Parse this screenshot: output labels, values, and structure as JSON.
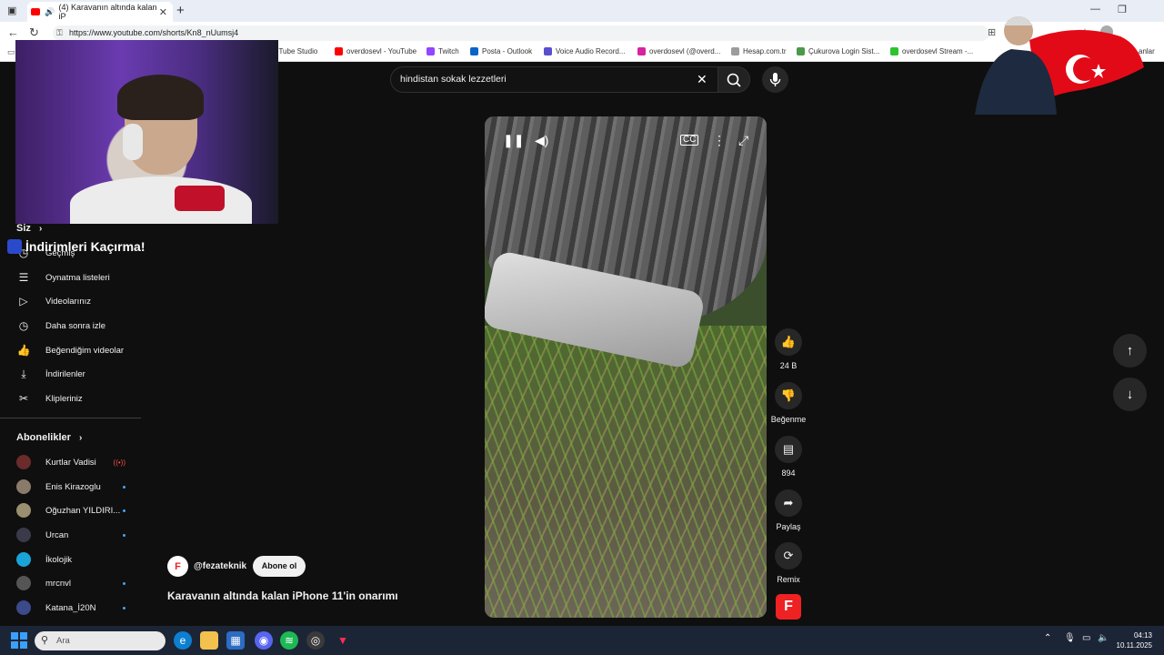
{
  "browser": {
    "tab_title": "(4) Karavanın altında kalan iP",
    "url": "https://www.youtube.com/shorts/Kn8_nUumsj4",
    "bookmarks": [
      {
        "label": "uTube Studio",
        "color": "#ff0000"
      },
      {
        "label": "overdosevl - YouTube",
        "color": "#ff0000"
      },
      {
        "label": "Twitch",
        "color": "#9146ff"
      },
      {
        "label": "Posta - Outlook",
        "color": "#0a64c8"
      },
      {
        "label": "Voice Audio Record...",
        "color": "#5a4fcf"
      },
      {
        "label": "overdosevl (@overd...",
        "color": "#d6249f"
      },
      {
        "label": "Hesap.com.tr",
        "color": "#9c9c9c"
      },
      {
        "label": "Çukurova Login Sist...",
        "color": "#4a9a4a"
      },
      {
        "label": "overdosevl Stream -...",
        "color": "#2ec22e"
      },
      {
        "label": "anlar",
        "color": "#555555"
      }
    ]
  },
  "search": {
    "query": "hindistan sokak lezzetleri"
  },
  "overlay": {
    "banner_text": "İndirimleri Kaçırma!"
  },
  "sidebar": {
    "you_section": "Siz",
    "items": [
      {
        "label": "Geçmiş",
        "icon": "history-icon"
      },
      {
        "label": "Oynatma listeleri",
        "icon": "playlist-icon"
      },
      {
        "label": "Videolarınız",
        "icon": "your-videos-icon"
      },
      {
        "label": "Daha sonra izle",
        "icon": "watch-later-icon"
      },
      {
        "label": "Beğendiğim videolar",
        "icon": "liked-icon"
      },
      {
        "label": "İndirilenler",
        "icon": "download-icon"
      },
      {
        "label": "Klipleriniz",
        "icon": "scissors-icon"
      }
    ],
    "subscriptions_section": "Abonelikler",
    "subscriptions": [
      {
        "name": "Kurtlar Vadisi",
        "live": true
      },
      {
        "name": "Enis Kirazoglu",
        "live": false
      },
      {
        "name": "Oğuzhan YILDIRI...",
        "live": false
      },
      {
        "name": "Urcan",
        "live": false
      },
      {
        "name": "İkolojik",
        "live": false
      },
      {
        "name": "mrcnvl",
        "live": false
      },
      {
        "name": "Katana_İ20N",
        "live": false
      }
    ]
  },
  "video": {
    "channel_handle": "@fezateknik",
    "subscribe_label": "Abone ol",
    "title": "Karavanın altında kalan iPhone 11'in onarımı"
  },
  "actions": {
    "like_count": "24 B",
    "dislike_label": "Beğenme",
    "comment_count": "894",
    "share_label": "Paylaş",
    "remix_label": "Remix"
  },
  "taskbar": {
    "search_placeholder": "Ara",
    "time": "04:13",
    "date": "10.11.2025"
  },
  "colors": {
    "brand_red": "#ff0000",
    "background": "#0f0f0f",
    "accent_blue": "#3ea6ff"
  }
}
